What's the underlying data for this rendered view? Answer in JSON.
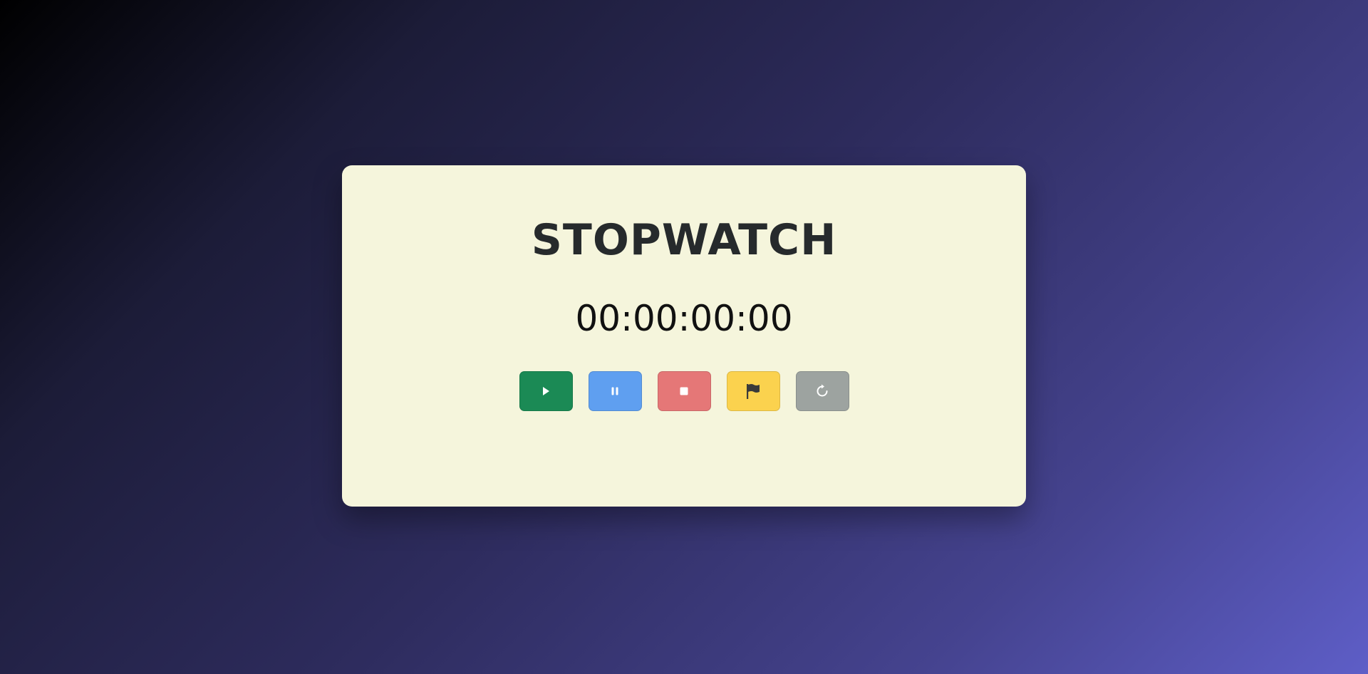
{
  "app": {
    "title": "STOPWATCH",
    "display": "00:00:00:00"
  },
  "controls": [
    {
      "name": "start-button",
      "icon": "play-icon",
      "color": "#1b8a55"
    },
    {
      "name": "pause-button",
      "icon": "pause-icon",
      "color": "#5f9ff0"
    },
    {
      "name": "stop-button",
      "icon": "stop-icon",
      "color": "#e57777"
    },
    {
      "name": "lap-button",
      "icon": "flag-icon",
      "color": "#fbd24e"
    },
    {
      "name": "reset-button",
      "icon": "reset-icon",
      "color": "#9da3a0"
    }
  ],
  "colors": {
    "card_background": "#f5f5dc",
    "title_text": "#262a2c",
    "timer_text": "#111111"
  }
}
